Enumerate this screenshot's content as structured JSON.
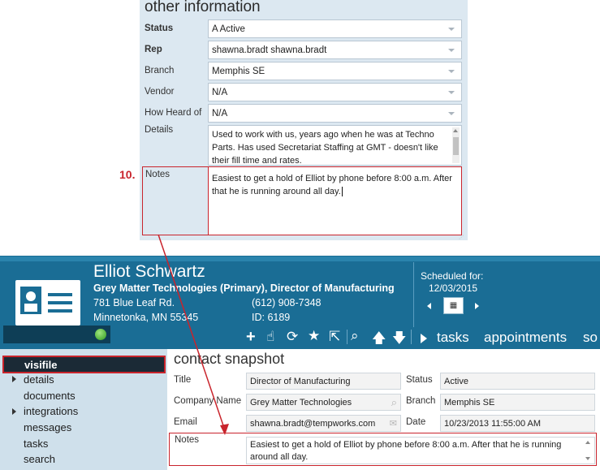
{
  "top_panel": {
    "title": "other information",
    "status_label": "Status",
    "status_value": "A  Active",
    "rep_label": "Rep",
    "rep_value": "shawna.bradt  shawna.bradt",
    "branch_label": "Branch",
    "branch_value": "Memphis SE",
    "vendor_label": "Vendor",
    "vendor_value": "N/A",
    "heard_label": "How Heard of",
    "heard_value": "N/A",
    "details_label": "Details",
    "details_value": "Used to work with us, years ago when he was at Techno Parts. Has used Secretariat Staffing at GMT - doesn't like their fill time and rates.",
    "notes_label": "Notes",
    "notes_value": "Easiest to get a hold of Elliot by phone before 8:00 a.m. After that he is running around all day."
  },
  "step_number": "10.",
  "header": {
    "name": "Elliot Schwartz",
    "company_line": "Grey Matter Technologies (Primary), Director of Manufacturing",
    "address1": "781 Blue Leaf Rd.",
    "address2": "Minnetonka, MN   55345",
    "phone": "(612) 908-7348",
    "id": "ID:  6189",
    "scheduled_label": "Scheduled for:",
    "scheduled_date": "12/03/2015",
    "tabs": [
      "tasks",
      "appointments",
      "so"
    ]
  },
  "sidebar": {
    "items": [
      "visifile",
      "details",
      "documents",
      "integrations",
      "messages",
      "tasks",
      "search"
    ]
  },
  "snapshot": {
    "title": "contact snapshot",
    "title_label": "Title",
    "title_value": "Director of Manufacturing",
    "company_label": "Company Name",
    "company_value": "Grey Matter Technologies",
    "email_label": "Email",
    "email_value": "shawna.bradt@tempworks.com",
    "status_label": "Status",
    "status_value": "Active",
    "branch_label": "Branch",
    "branch_value": "Memphis SE",
    "date_label": "Date",
    "date_value": "10/23/2013 11:55:00 AM",
    "notes_label": "Notes",
    "notes_value": "Easiest to get a hold of Elliot by phone before 8:00 a.m. After that he is running around all day."
  },
  "colors": {
    "header_blue": "#1a6d95",
    "highlight_red": "#c9242c",
    "panel_bg": "#dce8f1",
    "sidebar_bg": "#cfe0eb",
    "status_green": "#46b52a"
  },
  "icons": [
    "card-icon",
    "plus-icon",
    "hand-icon",
    "refresh-icon",
    "star-icon",
    "export-icon",
    "search-icon",
    "up-arrow-icon",
    "down-arrow-icon",
    "calendar-icon",
    "magnifier-icon",
    "mail-icon"
  ]
}
